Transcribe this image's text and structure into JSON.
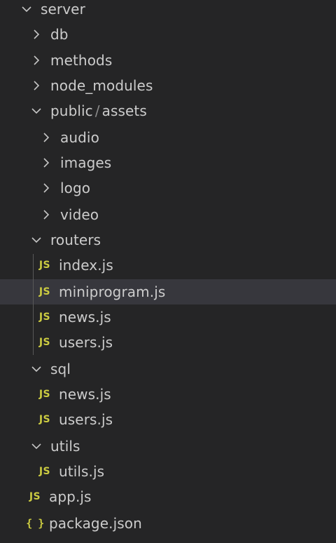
{
  "explorer": {
    "server": "server",
    "db": "db",
    "methods": "methods",
    "node_modules": "node_modules",
    "public": "public",
    "path_separator": "/",
    "assets": "assets",
    "audio": "audio",
    "images": "images",
    "logo": "logo",
    "video": "video",
    "routers": "routers",
    "routers_index": "index.js",
    "routers_miniprogram": "miniprogram.js",
    "routers_news": "news.js",
    "routers_users": "users.js",
    "sql": "sql",
    "sql_news": "news.js",
    "sql_users": "users.js",
    "utils": "utils",
    "utils_utils": "utils.js",
    "app": "app.js",
    "package": "package.json"
  },
  "icons": {
    "js_badge": "JS",
    "json_badge": "{ }",
    "js_color": "#cbcb41",
    "selection_color": "#37373d"
  }
}
